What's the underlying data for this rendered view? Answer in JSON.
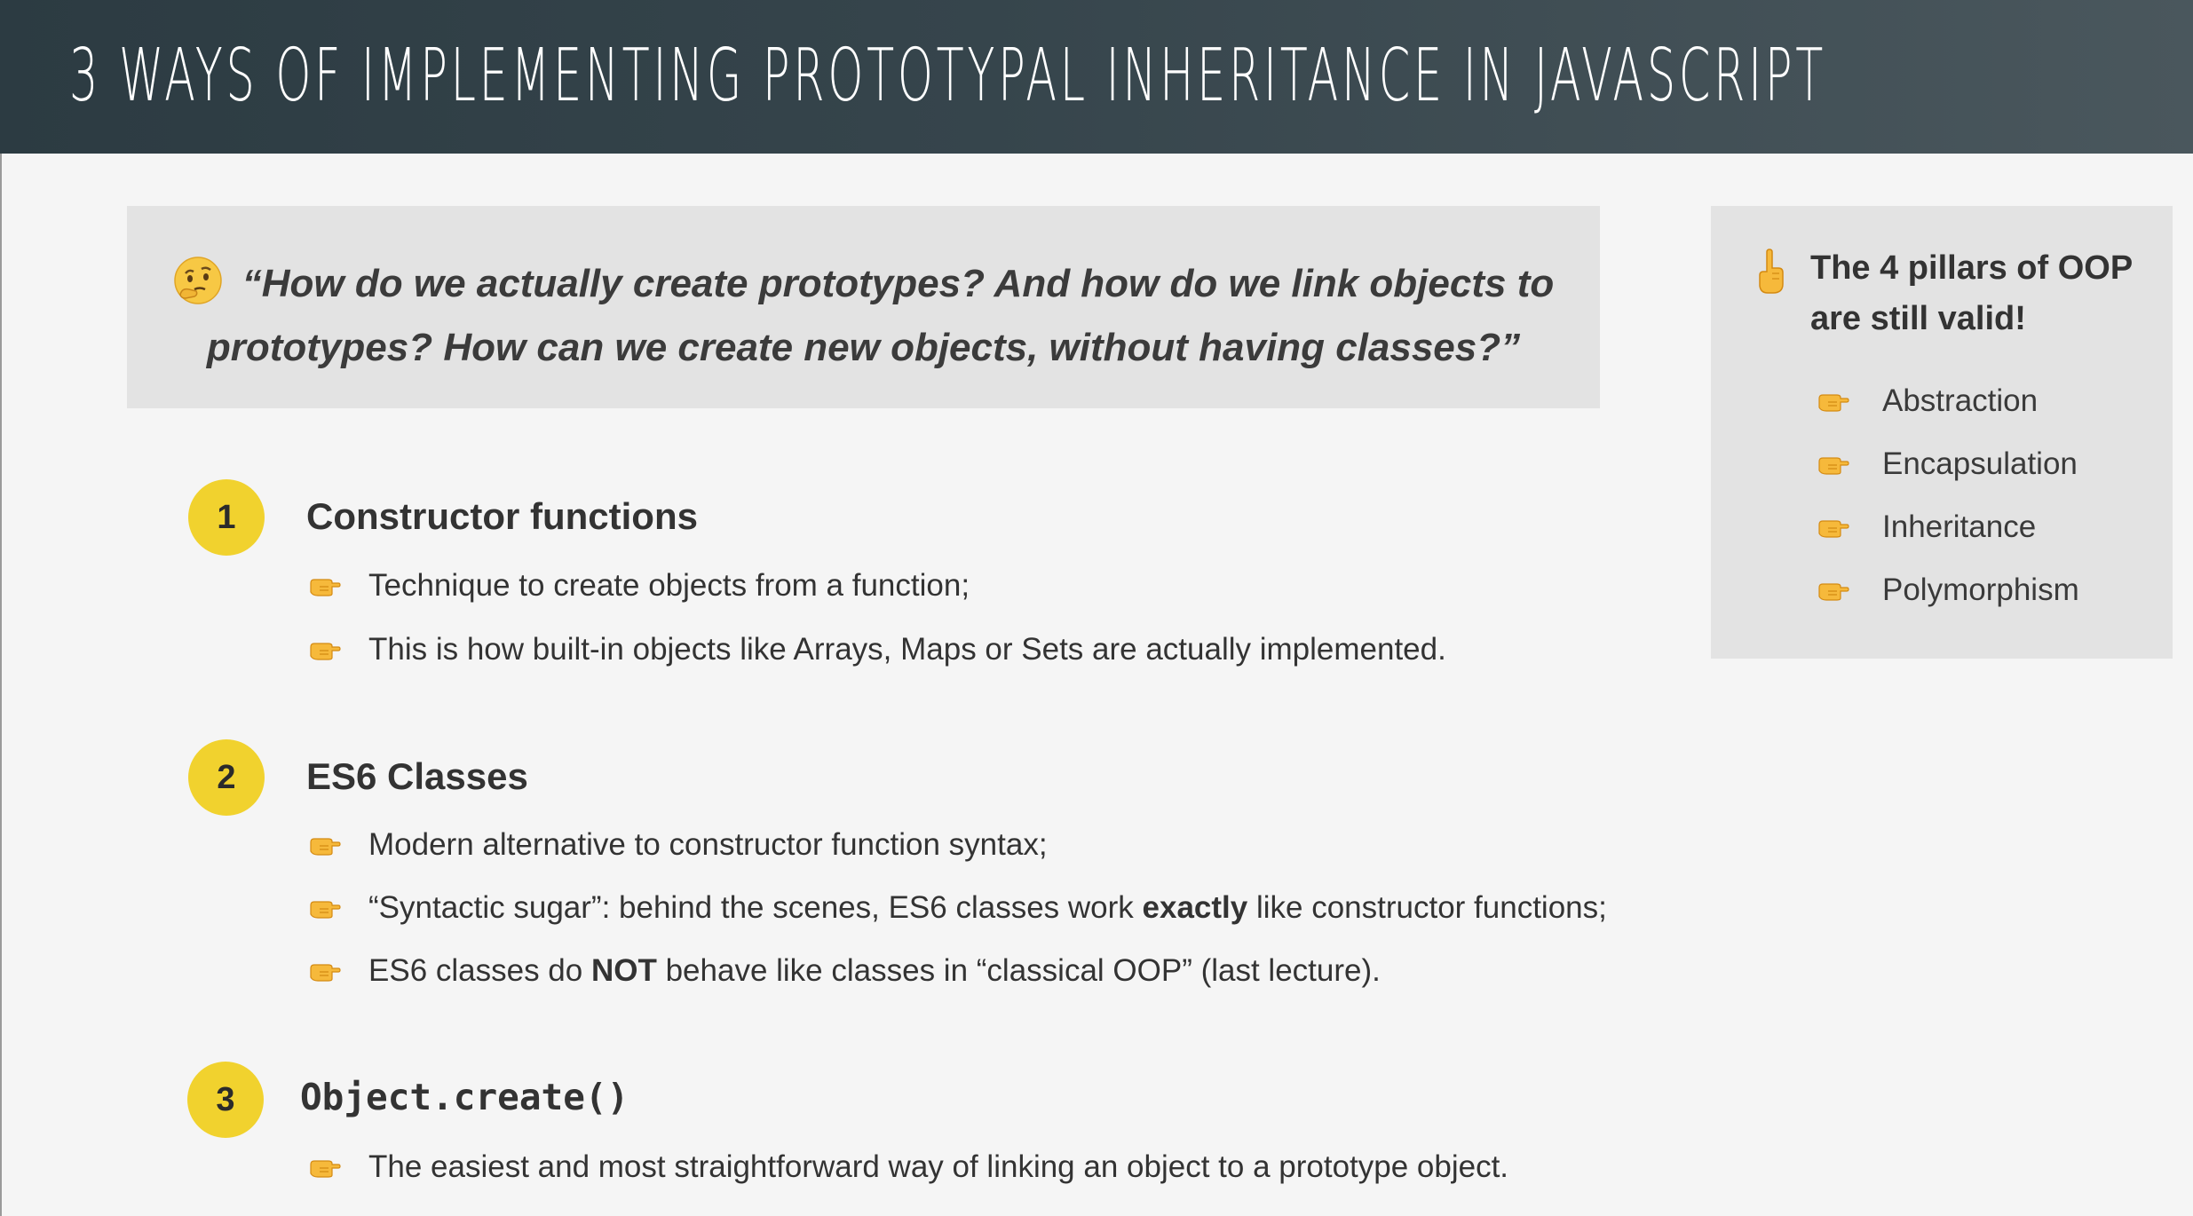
{
  "header": {
    "title": "3 WAYS OF IMPLEMENTING PROTOTYPAL INHERITANCE IN JAVASCRIPT"
  },
  "question": {
    "icon": "thinking-face-icon",
    "text": "“How do we actually create prototypes? And how do we link objects to prototypes? How can we create new objects, without having classes?”"
  },
  "pillars": {
    "icon": "index-pointing-up-icon",
    "title": "The 4 pillars of OOP are still valid!",
    "items": [
      {
        "label": "Abstraction"
      },
      {
        "label": "Encapsulation"
      },
      {
        "label": "Inheritance"
      },
      {
        "label": "Polymorphism"
      }
    ]
  },
  "sections": [
    {
      "number": "1",
      "title": "Constructor functions",
      "bullets": [
        {
          "text": "Technique to create objects from a function;"
        },
        {
          "text": "This is how built-in objects like Arrays, Maps or Sets are actually implemented."
        }
      ]
    },
    {
      "number": "2",
      "title": "ES6 Classes",
      "bullets": [
        {
          "text": "Modern alternative to constructor function syntax;"
        },
        {
          "pre": "“Syntactic sugar”: behind the scenes, ES6 classes work ",
          "bold": "exactly",
          "post": " like constructor functions;"
        },
        {
          "pre": "ES6 classes do ",
          "bold": "NOT",
          "post": " behave like classes in “classical OOP” (last lecture)."
        }
      ]
    },
    {
      "number": "3",
      "title": "Object.create()",
      "bullets": [
        {
          "text": "The easiest and most straightforward way of linking an object to a prototype object."
        }
      ]
    }
  ],
  "colors": {
    "header_start": "#2c3b42",
    "header_end": "#4a575d",
    "accent_yellow": "#f1d22e",
    "box_gray": "#e3e3e3",
    "page_bg": "#f5f5f5"
  }
}
